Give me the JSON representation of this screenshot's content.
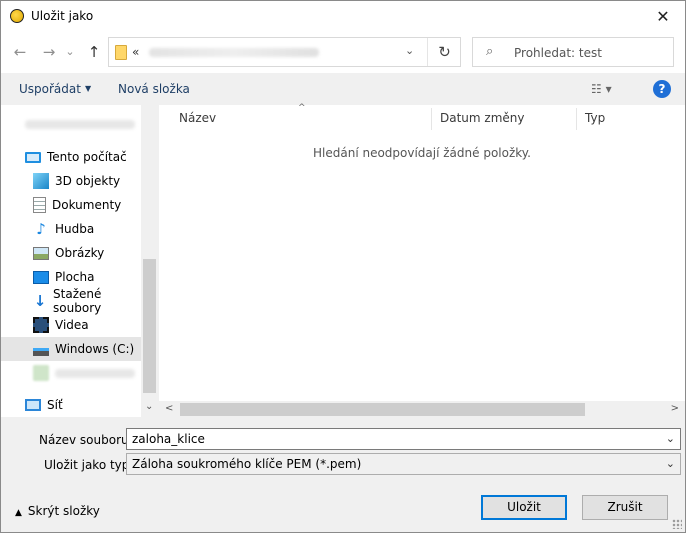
{
  "window": {
    "title": "Uložit jako",
    "close_glyph": "✕"
  },
  "nav": {
    "back_glyph": "←",
    "forward_glyph": "→",
    "recent_glyph": "⌄",
    "up_glyph": "↑",
    "address_chevron": "«",
    "address_dropdown": "⌄",
    "refresh_glyph": "↻",
    "search_icon": "⌕",
    "search_placeholder": "Prohledat: test"
  },
  "toolbar": {
    "organize_label": "Uspořádat",
    "organize_caret": "▼",
    "new_folder_label": "Nová složka",
    "view_glyph": "☷ ▾",
    "help_glyph": "?"
  },
  "sidebar": {
    "items": [
      {
        "label": "Tento počítač",
        "icon": "computer-icon"
      },
      {
        "label": "3D objekty",
        "icon": "3d-objects-icon"
      },
      {
        "label": "Dokumenty",
        "icon": "documents-icon"
      },
      {
        "label": "Hudba",
        "icon": "music-icon"
      },
      {
        "label": "Obrázky",
        "icon": "pictures-icon"
      },
      {
        "label": "Plocha",
        "icon": "desktop-icon"
      },
      {
        "label": "Stažené soubory",
        "icon": "downloads-icon"
      },
      {
        "label": "Videa",
        "icon": "videos-icon"
      },
      {
        "label": "Windows (C:)",
        "icon": "drive-icon"
      },
      {
        "label": "Síť",
        "icon": "network-icon"
      }
    ],
    "scroll_down_glyph": "⌄"
  },
  "filelist": {
    "columns": [
      {
        "label": "Název"
      },
      {
        "label": "Datum změny"
      },
      {
        "label": "Typ"
      }
    ],
    "sort_glyph": "^",
    "empty_message": "Hledání neodpovídají žádné položky.",
    "hscroll_left": "<",
    "hscroll_right": ">"
  },
  "form": {
    "filename_label": "Název souboru:",
    "filename_value": "zaloha_klice",
    "filetype_label": "Uložit jako typ:",
    "filetype_value": "Záloha soukromého klíče PEM (*.pem)",
    "dropdown_glyph": "⌄"
  },
  "footer": {
    "hide_folders_label": "Skrýt složky",
    "hide_folders_caret": "▲",
    "save_label": "Uložit",
    "cancel_label": "Zrušit"
  },
  "colors": {
    "accent": "#0078d7",
    "link_blue": "#1f3f66",
    "selection": "#e5e5e5"
  }
}
